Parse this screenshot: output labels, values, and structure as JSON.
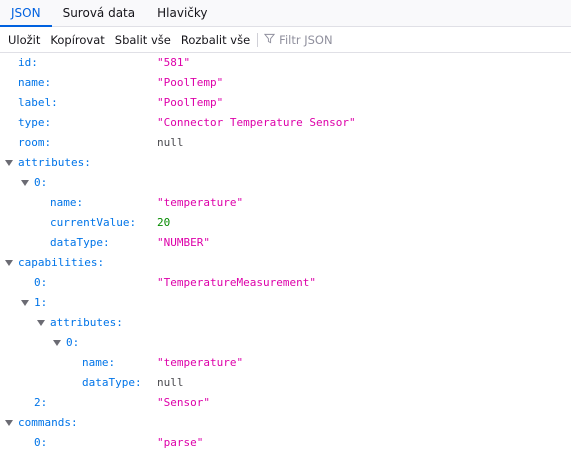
{
  "tabs": [
    {
      "label": "JSON",
      "active": true
    },
    {
      "label": "Surová data",
      "active": false
    },
    {
      "label": "Hlavičky",
      "active": false
    }
  ],
  "toolbar": {
    "save": "Uložit",
    "copy": "Kopírovat",
    "collapse_all": "Sbalit vše",
    "expand_all": "Rozbalit vše",
    "filter_placeholder": "Filtr JSON"
  },
  "colors": {
    "accent": "#0061e0",
    "key": "#0074e8",
    "string": "#dd00a9",
    "number": "#058b00",
    "null": "#4a4a4f"
  },
  "rows": [
    {
      "key": "id:",
      "value": "\"581\"",
      "type": "str",
      "depth": 0
    },
    {
      "key": "name:",
      "value": "\"PoolTemp\"",
      "type": "str",
      "depth": 0
    },
    {
      "key": "label:",
      "value": "\"PoolTemp\"",
      "type": "str",
      "depth": 0
    },
    {
      "key": "type:",
      "value": "\"Connector Temperature Sensor\"",
      "type": "str",
      "depth": 0
    },
    {
      "key": "room:",
      "value": "null",
      "type": "nul",
      "depth": 0
    },
    {
      "key": "attributes:",
      "value": "",
      "type": "obj",
      "depth": 0
    },
    {
      "key": "0:",
      "value": "",
      "type": "obj",
      "depth": 1
    },
    {
      "key": "name:",
      "value": "\"temperature\"",
      "type": "str",
      "depth": 2
    },
    {
      "key": "currentValue:",
      "value": "20",
      "type": "num",
      "depth": 2
    },
    {
      "key": "dataType:",
      "value": "\"NUMBER\"",
      "type": "str",
      "depth": 2
    },
    {
      "key": "capabilities:",
      "value": "",
      "type": "obj",
      "depth": 0
    },
    {
      "key": "0:",
      "value": "\"TemperatureMeasurement\"",
      "type": "str",
      "depth": 1
    },
    {
      "key": "1:",
      "value": "",
      "type": "obj",
      "depth": 1
    },
    {
      "key": "attributes:",
      "value": "",
      "type": "obj",
      "depth": 2
    },
    {
      "key": "0:",
      "value": "",
      "type": "obj",
      "depth": 3
    },
    {
      "key": "name:",
      "value": "\"temperature\"",
      "type": "str",
      "depth": 4
    },
    {
      "key": "dataType:",
      "value": "null",
      "type": "nul",
      "depth": 4
    },
    {
      "key": "2:",
      "value": "\"Sensor\"",
      "type": "str",
      "depth": 1
    },
    {
      "key": "commands:",
      "value": "",
      "type": "obj",
      "depth": 0
    },
    {
      "key": "0:",
      "value": "\"parse\"",
      "type": "str",
      "depth": 1
    }
  ]
}
